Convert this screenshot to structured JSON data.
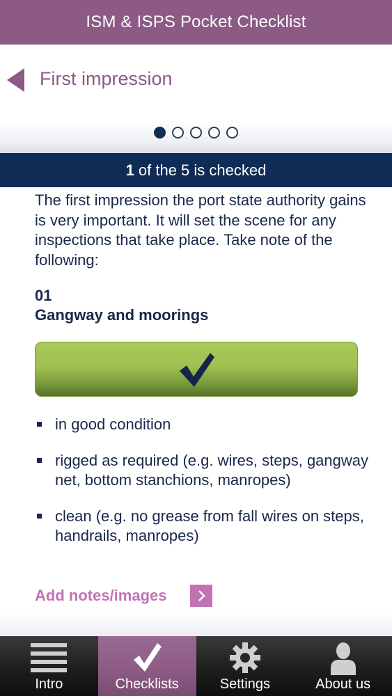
{
  "app": {
    "title": "ISM & ISPS Pocket Checklist"
  },
  "header": {
    "section_title": "First impression",
    "pager": {
      "count": 5,
      "active_index": 0
    }
  },
  "status": {
    "checked_count": "1",
    "text": "of the 5 is checked"
  },
  "content": {
    "intro": "The first impression the port state authority gains is very important. It will set the scene for any inspections that take place. Take note of the following:",
    "item": {
      "number": "01",
      "title": "Gangway and moorings",
      "checked": true,
      "bullets": [
        "in good condition",
        "rigged as required (e.g. wires, steps, gangway net, bottom stanchions, manropes)",
        "clean (e.g. no grease from fall wires on steps, handrails, manropes)"
      ]
    },
    "add_notes_label": "Add notes/images"
  },
  "tabs": [
    {
      "label": "Intro",
      "icon": "list-icon",
      "active": false
    },
    {
      "label": "Checklists",
      "icon": "checkmark-icon",
      "active": true
    },
    {
      "label": "Settings",
      "icon": "gear-icon",
      "active": false
    },
    {
      "label": "About us",
      "icon": "person-icon",
      "active": false
    }
  ],
  "colors": {
    "brand_purple": "#8c5a84",
    "navy": "#0f2c57",
    "check_green": "#9fc152",
    "link_pink": "#c172b5"
  }
}
